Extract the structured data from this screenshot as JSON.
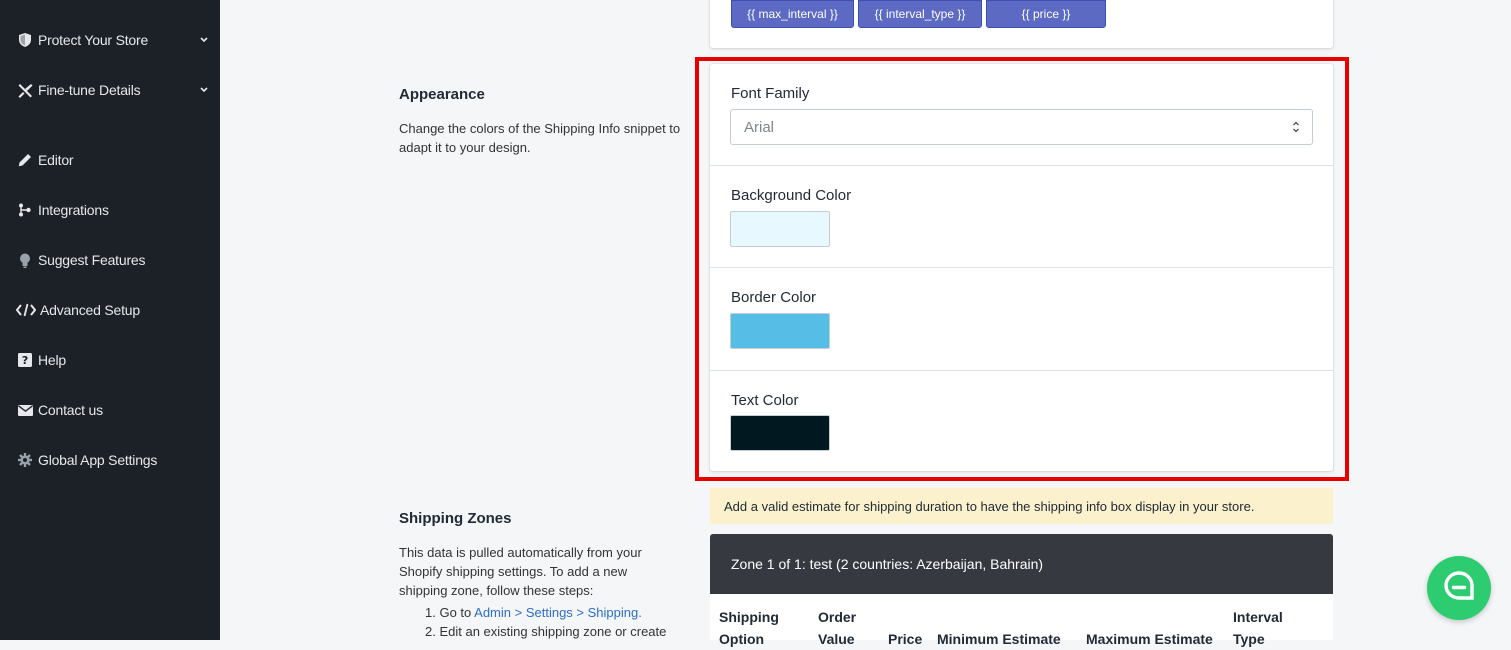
{
  "sidebar": {
    "items": [
      {
        "label": "Protect Your Store",
        "icon": "shield-icon",
        "expandable": true
      },
      {
        "label": "Fine-tune Details",
        "icon": "tools-icon",
        "expandable": true
      },
      {
        "label": "Editor",
        "icon": "pencil-icon"
      },
      {
        "label": "Integrations",
        "icon": "integrations-icon"
      },
      {
        "label": "Suggest Features",
        "icon": "lightbulb-icon"
      },
      {
        "label": "Advanced Setup",
        "icon": "code-icon"
      },
      {
        "label": "Help",
        "icon": "help-icon"
      },
      {
        "label": "Contact us",
        "icon": "envelope-icon"
      },
      {
        "label": "Global App Settings",
        "icon": "gear-icon"
      }
    ]
  },
  "variables": {
    "buttons": [
      "{{ max_interval }}",
      "{{ interval_type }}",
      "{{ price }}"
    ]
  },
  "appearance": {
    "title": "Appearance",
    "description": "Change the colors of the Shipping Info snippet to adapt it to your design.",
    "font_family_label": "Font Family",
    "font_family_value": "Arial",
    "background_color_label": "Background Color",
    "background_color": "#e8f8ff",
    "border_color_label": "Border Color",
    "border_color": "#55bde6",
    "text_color_label": "Text Color",
    "text_color": "#021820"
  },
  "shipping_zones": {
    "title": "Shipping Zones",
    "description": "This data is pulled automatically from your Shopify shipping settings. To add a new shipping zone, follow these steps:",
    "step1_prefix": "1. Go to ",
    "step1_link": "Admin > Settings > Shipping.",
    "step2": "2. Edit an existing shipping zone or create",
    "warning": "Add a valid estimate for shipping duration to have the shipping info box display in your store.",
    "zone_header": "Zone 1 of 1: test (2 countries: Azerbaijan, Bahrain)",
    "columns": [
      "Shipping Option",
      "Order Value",
      "Price",
      "Minimum Estimate",
      "Maximum Estimate",
      "Interval Type"
    ]
  }
}
